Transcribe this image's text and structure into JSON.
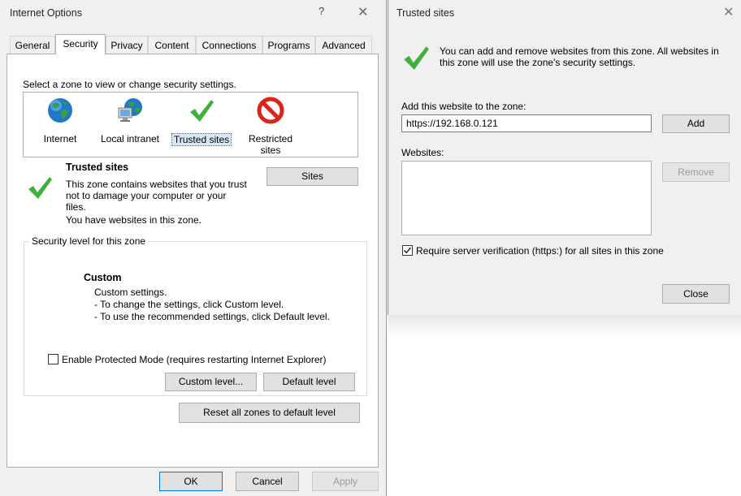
{
  "internet_options": {
    "title": "Internet Options",
    "help_glyph": "?",
    "close_glyph": "✕",
    "tabs": [
      {
        "label": "General"
      },
      {
        "label": "Security"
      },
      {
        "label": "Privacy"
      },
      {
        "label": "Content"
      },
      {
        "label": "Connections"
      },
      {
        "label": "Programs"
      },
      {
        "label": "Advanced"
      }
    ],
    "zone_prompt": "Select a zone to view or change security settings.",
    "zones": [
      {
        "label": "Internet"
      },
      {
        "label": "Local intranet"
      },
      {
        "label": "Trusted sites"
      },
      {
        "label": "Restricted\nsites"
      }
    ],
    "zone_info": {
      "title": "Trusted sites",
      "description": "This zone contains websites that you trust not to damage your computer or your files.",
      "status": "You have websites in this zone.",
      "sites_button": "Sites"
    },
    "security_level": {
      "group_label": "Security level for this zone",
      "level_name": "Custom",
      "line1": "Custom settings.",
      "line2": "- To change the settings, click Custom level.",
      "line3": "- To use the recommended settings, click Default level."
    },
    "protected_mode": {
      "label": "Enable Protected Mode (requires restarting Internet Explorer)",
      "checked": false
    },
    "custom_level_button": "Custom level...",
    "default_level_button": "Default level",
    "reset_button": "Reset all zones to default level",
    "ok_button": "OK",
    "cancel_button": "Cancel",
    "apply_button": "Apply"
  },
  "trusted_sites": {
    "title": "Trusted sites",
    "close_glyph": "✕",
    "intro": "You can add and remove websites from this zone. All websites in this zone will use the zone's security settings.",
    "add_label": "Add this website to the zone:",
    "add_value": "https://192.168.0.121",
    "add_button": "Add",
    "websites_label": "Websites:",
    "remove_button": "Remove",
    "require_https": {
      "label": "Require server verification (https:) for all sites in this zone",
      "checked": true
    },
    "close_button": "Close"
  },
  "colors": {
    "check_green": "#3fb13a",
    "globe_blue": "#1f78c8",
    "restricted_red": "#d9261c",
    "accent_border": "#0078d7"
  }
}
